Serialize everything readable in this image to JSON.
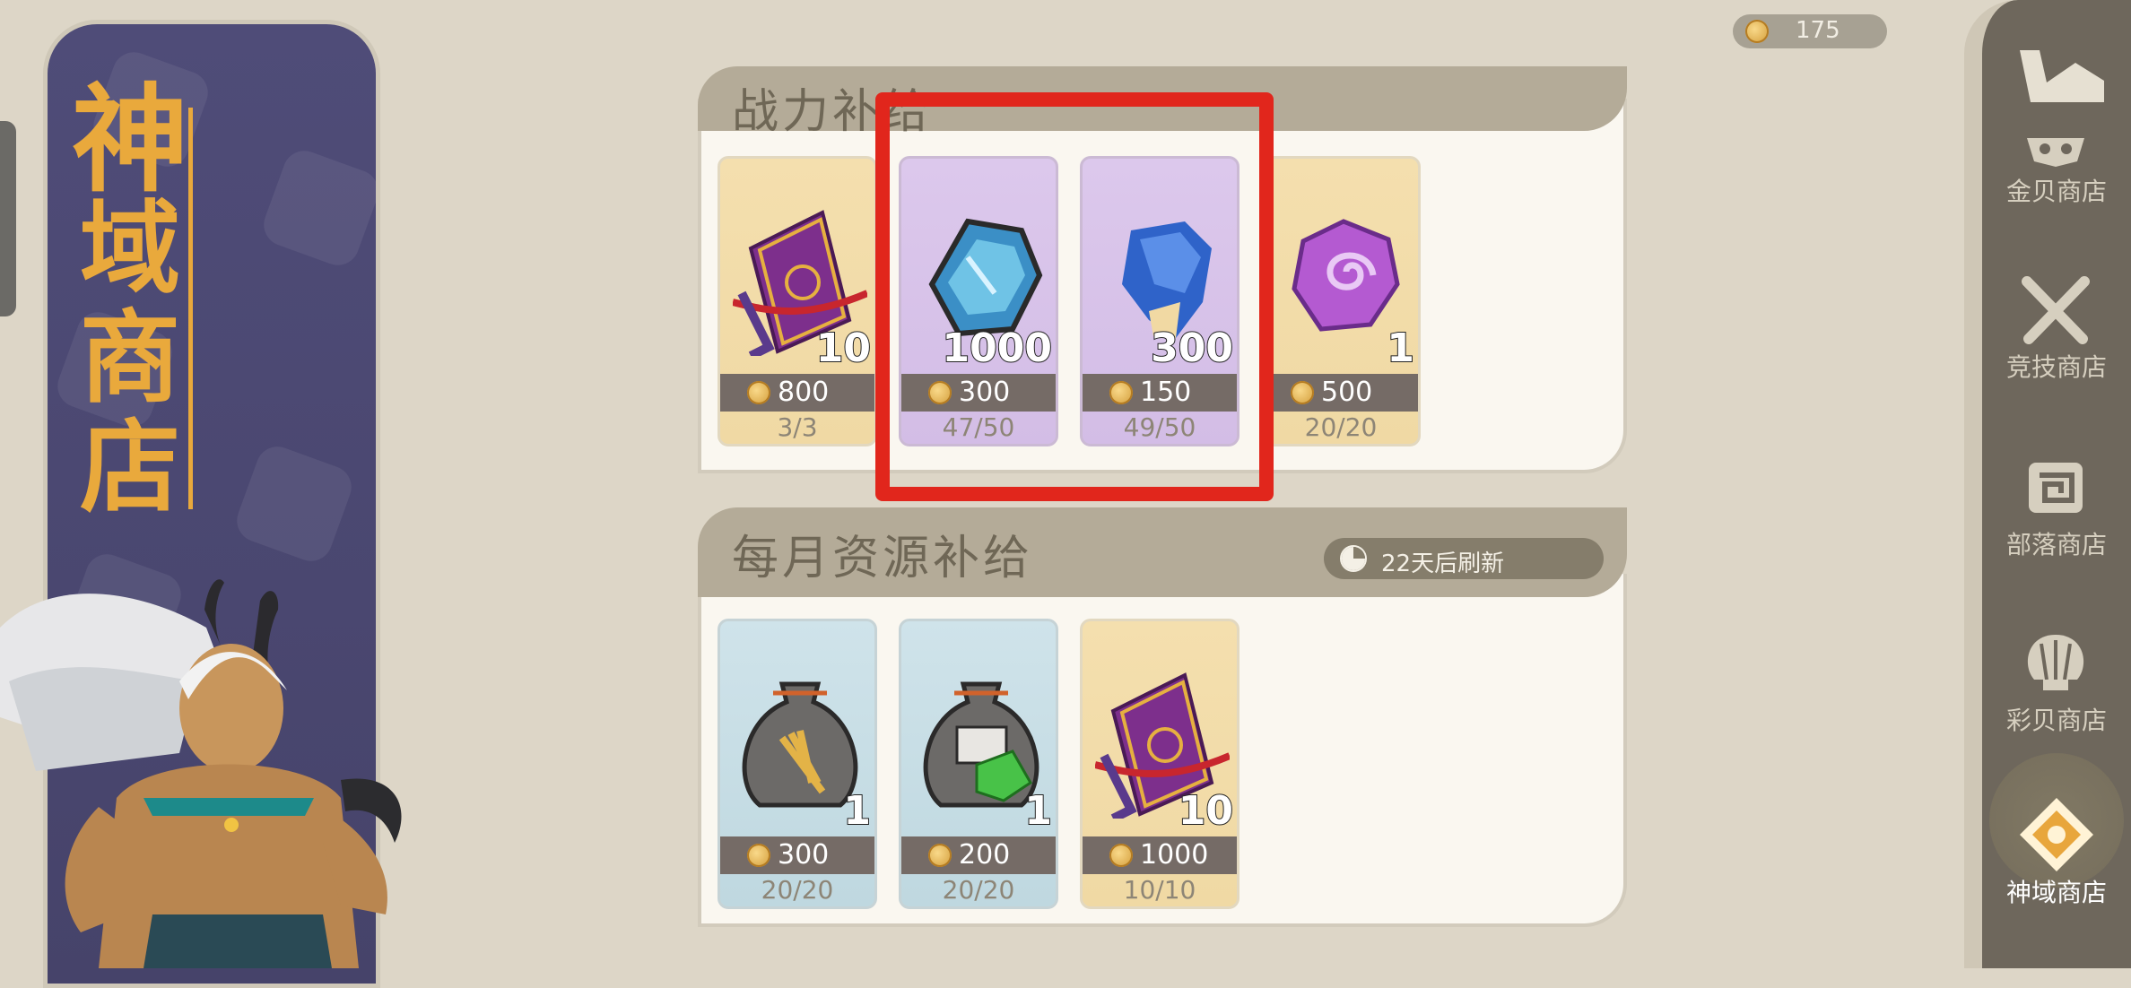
{
  "currency": {
    "icon": "gold-shell-coin-icon",
    "amount": "175"
  },
  "left_banner": {
    "title_chars": [
      "神",
      "域",
      "商",
      "店"
    ]
  },
  "sections": [
    {
      "title": "战力补给",
      "items": [
        {
          "icon": "purple-spell-book-icon",
          "quantity": "10",
          "price": "800",
          "limit": "3/3",
          "theme": "gold"
        },
        {
          "icon": "blue-hexagon-gem-icon",
          "quantity": "1000",
          "price": "300",
          "limit": "47/50",
          "theme": "purple"
        },
        {
          "icon": "blue-crystal-ore-icon",
          "quantity": "300",
          "price": "150",
          "limit": "49/50",
          "theme": "purple"
        },
        {
          "icon": "purple-spiral-token-icon",
          "quantity": "1",
          "price": "500",
          "limit": "20/20",
          "theme": "gold"
        }
      ]
    },
    {
      "title": "每月资源补给",
      "refresh": "22天后刷新",
      "items": [
        {
          "icon": "wheat-sack-icon",
          "quantity": "1",
          "price": "300",
          "limit": "20/20",
          "theme": "blue"
        },
        {
          "icon": "green-gem-sack-icon",
          "quantity": "1",
          "price": "200",
          "limit": "20/20",
          "theme": "blue"
        },
        {
          "icon": "purple-spell-book-icon",
          "quantity": "10",
          "price": "1000",
          "limit": "10/10",
          "theme": "gold"
        }
      ]
    }
  ],
  "nav": [
    {
      "label": "金贝商店",
      "icon": "mask-icon",
      "active": false
    },
    {
      "label": "竞技商店",
      "icon": "crossed-swords-icon",
      "active": false
    },
    {
      "label": "部落商店",
      "icon": "tribe-totem-icon",
      "active": false
    },
    {
      "label": "彩贝商店",
      "icon": "shell-icon",
      "active": false
    },
    {
      "label": "神域商店",
      "icon": "divine-realm-emblem-icon",
      "active": true
    }
  ],
  "colors": {
    "highlight": "#e1261c",
    "title_gold": "#e9a93c",
    "banner": "#4f4c78"
  }
}
